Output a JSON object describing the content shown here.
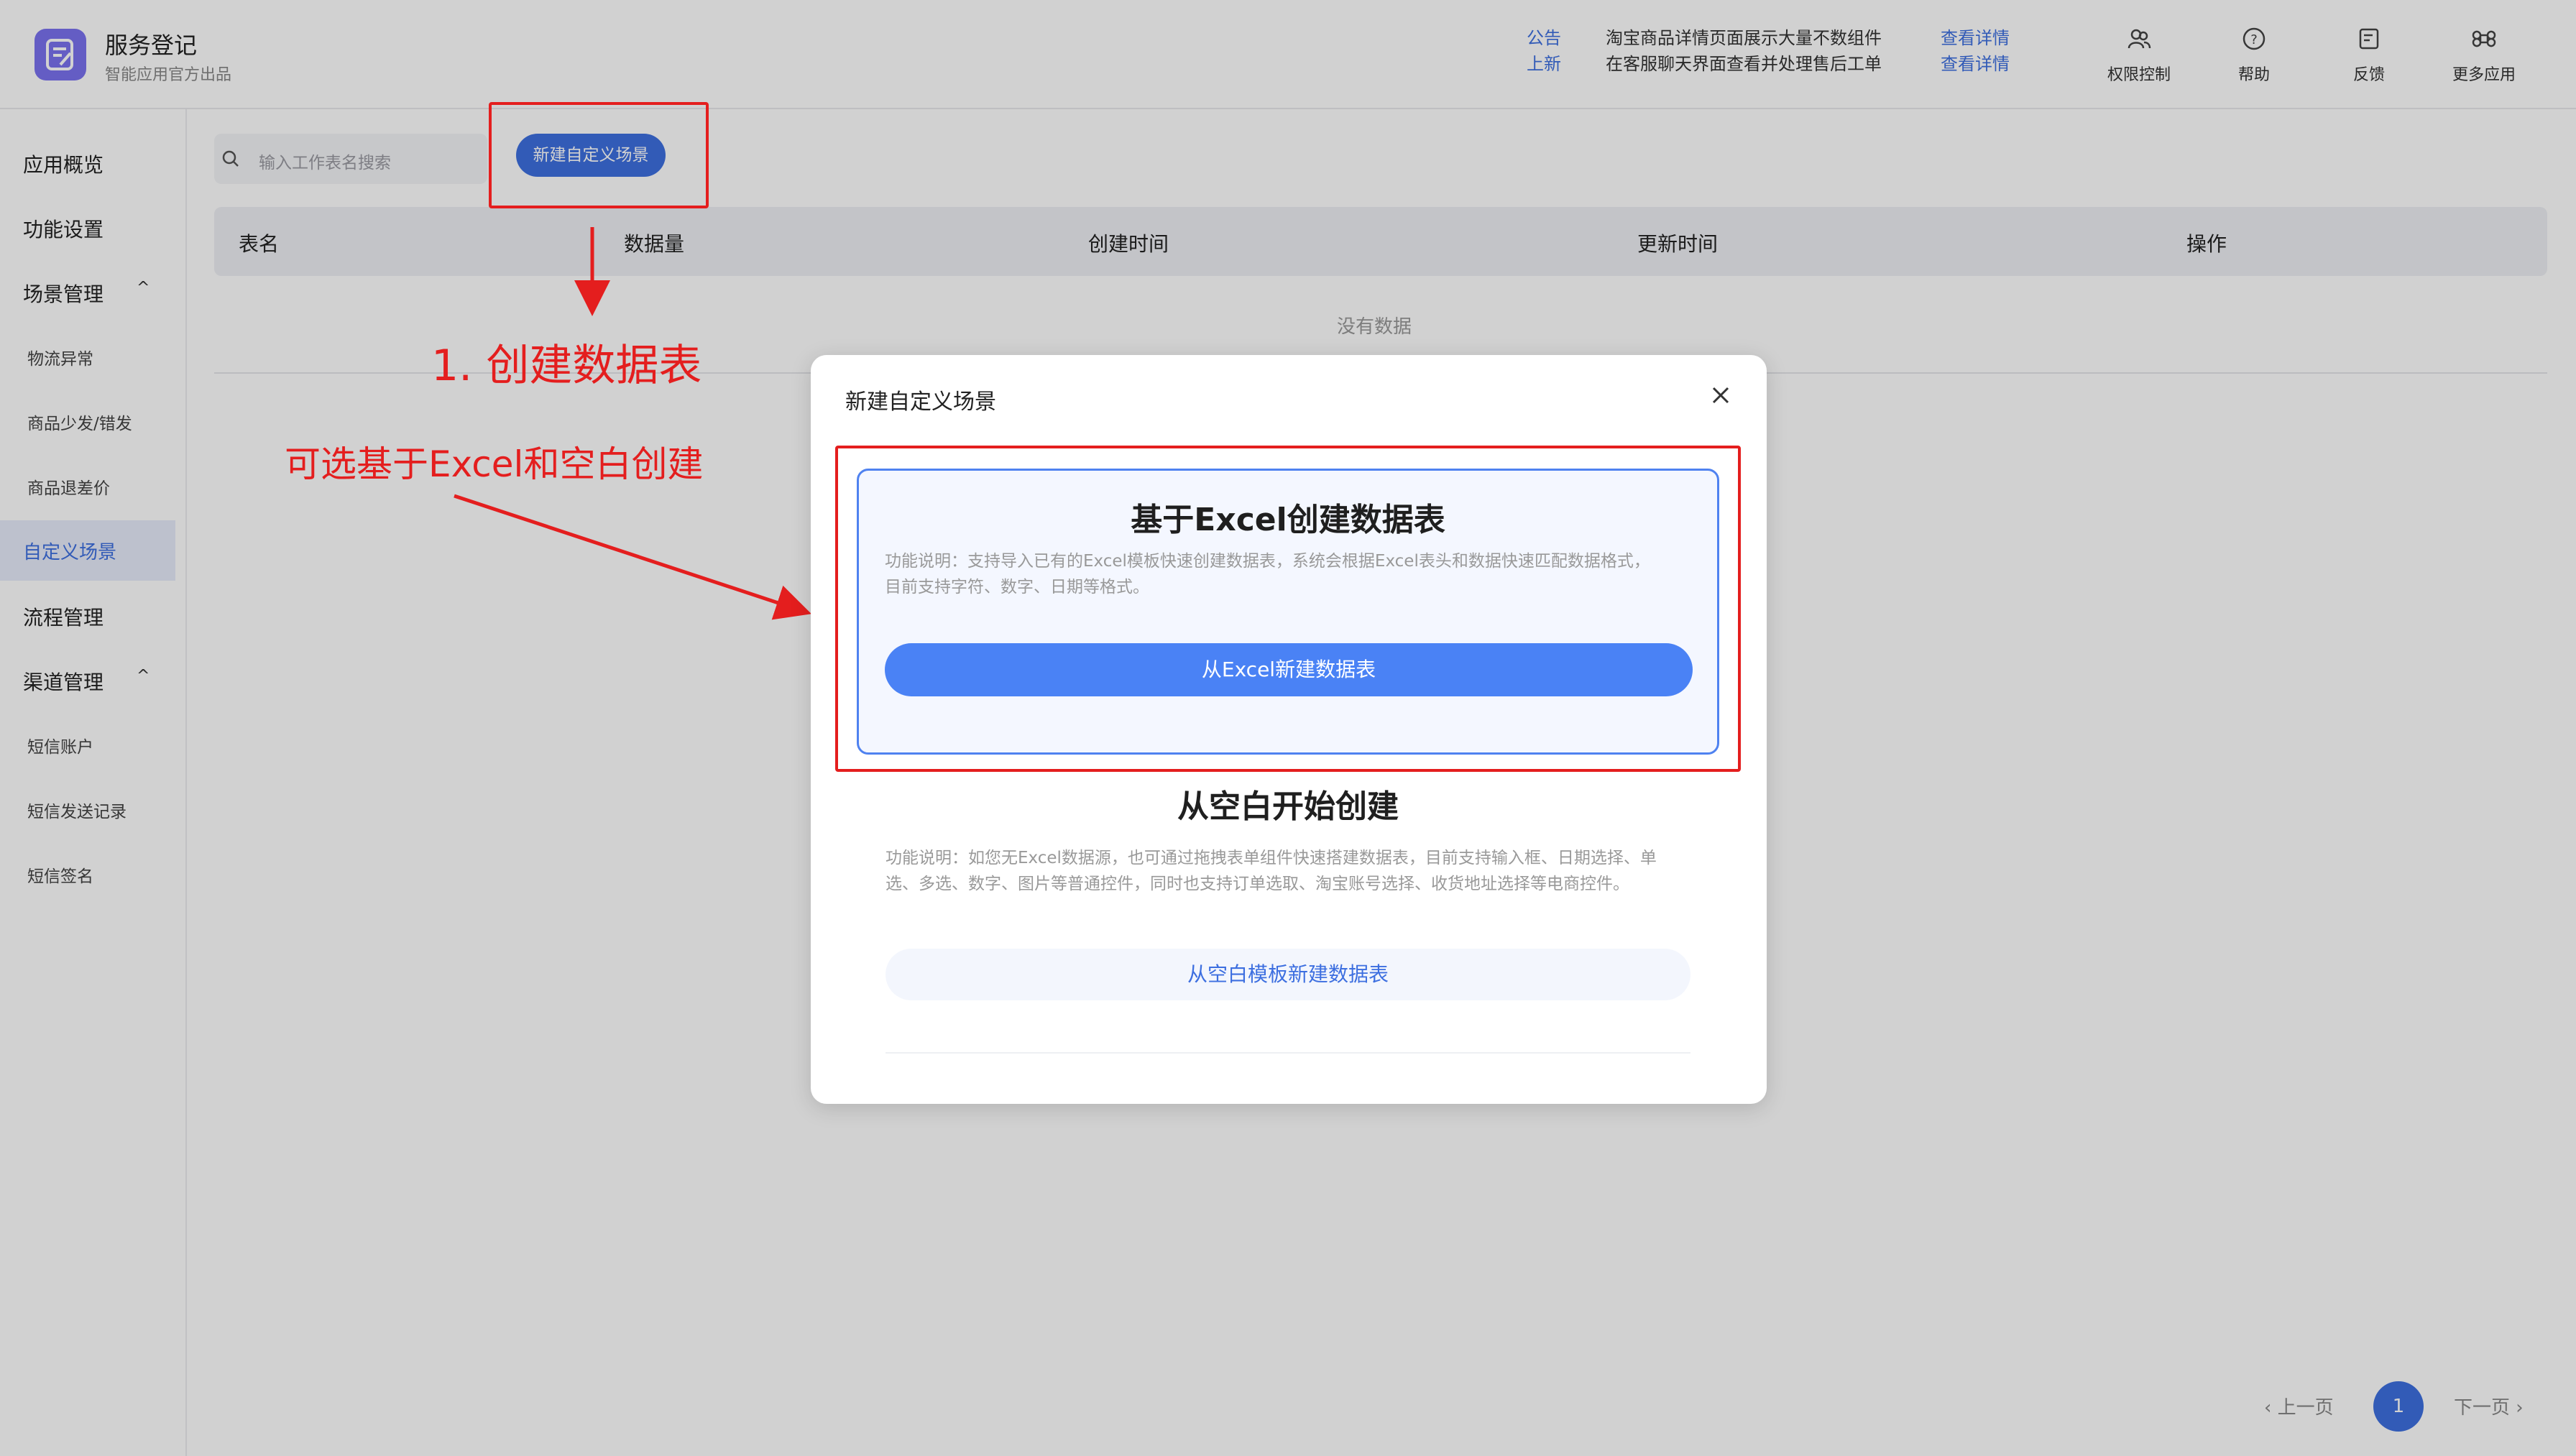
{
  "header": {
    "app_title": "服务登记",
    "app_subtitle": "智能应用官方出品",
    "notices": [
      {
        "tag": "公告",
        "text": "淘宝商品详情页面展示大量不数组件",
        "link": "查看详情"
      },
      {
        "tag": "上新",
        "text": "在客服聊天界面查看并处理售后工单",
        "link": "查看详情"
      }
    ],
    "actions": [
      {
        "label": "权限控制",
        "icon": "users-icon"
      },
      {
        "label": "帮助",
        "icon": "help-icon"
      },
      {
        "label": "反馈",
        "icon": "feedback-icon"
      },
      {
        "label": "更多应用",
        "icon": "command-icon"
      }
    ]
  },
  "sidebar": {
    "items": [
      {
        "label": "应用概览",
        "level": 1
      },
      {
        "label": "功能设置",
        "level": 1
      },
      {
        "label": "场景管理",
        "level": 1,
        "caret": "^"
      },
      {
        "label": "物流异常",
        "level": 2
      },
      {
        "label": "商品少发/错发",
        "level": 2
      },
      {
        "label": "商品退差价",
        "level": 2
      },
      {
        "label": "自定义场景",
        "level": 2,
        "active": true
      },
      {
        "label": "流程管理",
        "level": 1
      },
      {
        "label": "渠道管理",
        "level": 1,
        "caret": "^"
      },
      {
        "label": "短信账户",
        "level": 2
      },
      {
        "label": "短信发送记录",
        "level": 2
      },
      {
        "label": "短信签名",
        "level": 2
      }
    ]
  },
  "main": {
    "search_placeholder": "输入工作表名搜索",
    "new_button": "新建自定义场景",
    "columns": [
      "表名",
      "数据量",
      "创建时间",
      "更新时间",
      "操作"
    ],
    "empty_text": "没有数据"
  },
  "pagination": {
    "prev": "‹ 上一页",
    "current": "1",
    "next": "下一页 ›"
  },
  "annotations": {
    "step1": "1. 创建数据表",
    "note": "可选基于Excel和空白创建"
  },
  "modal": {
    "title": "新建自定义场景",
    "option_excel": {
      "heading": "基于Excel创建数据表",
      "desc_line1": "功能说明：支持导入已有的Excel模板快速创建数据表，系统会根据Excel表头和数据快速匹配数据格式，",
      "desc_line2": "目前支持字符、数字、日期等格式。",
      "button": "从Excel新建数据表"
    },
    "option_blank": {
      "heading": "从空白开始创建",
      "desc_line1": "功能说明：如您无Excel数据源，也可通过拖拽表单组件快速搭建数据表，目前支持输入框、日期选择、单",
      "desc_line2": "选、多选、数字、图片等普通控件，同时也支持订单选取、淘宝账号选择、收货地址选择等电商控件。",
      "button": "从空白模板新建数据表"
    }
  },
  "colors": {
    "accent": "#3d6fe0",
    "annotation_red": "#e41e1e",
    "logo_purple": "#7a72f0"
  }
}
